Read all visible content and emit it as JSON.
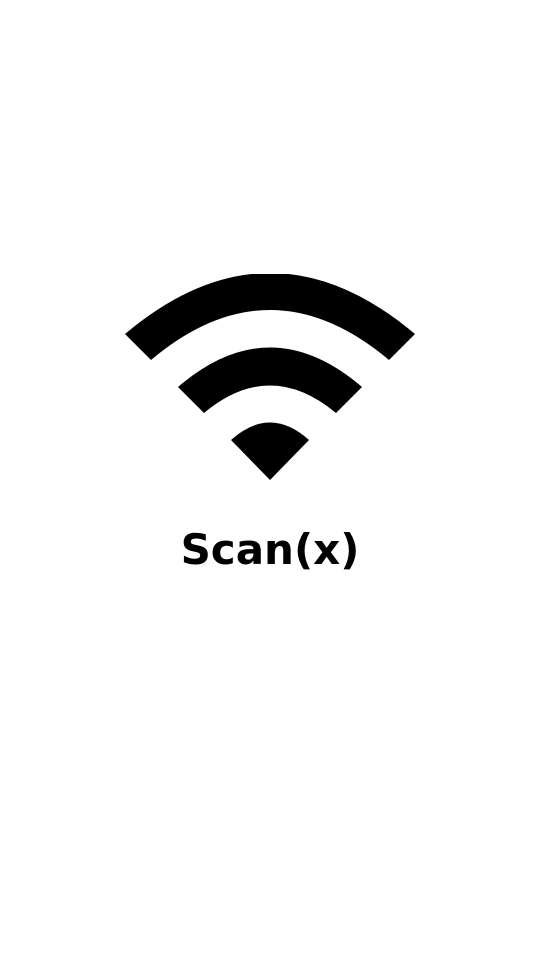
{
  "splash": {
    "app_name": "Scan(x)",
    "logo_icon": "wifi-signal-icon"
  },
  "colors": {
    "background": "#ffffff",
    "foreground": "#000000"
  }
}
